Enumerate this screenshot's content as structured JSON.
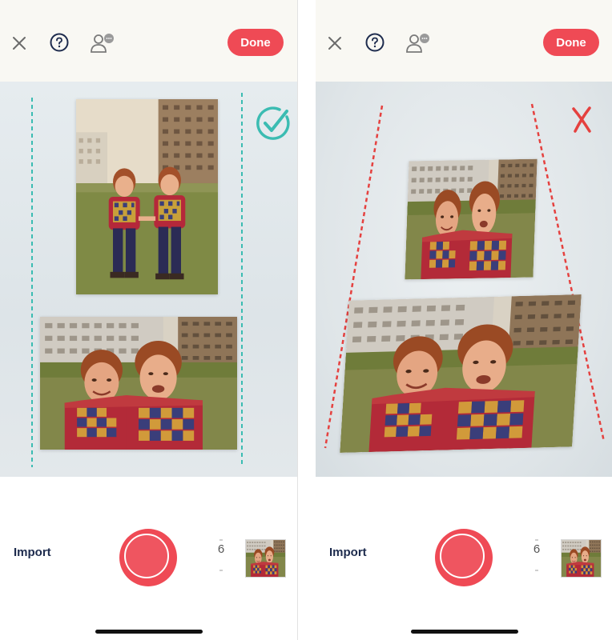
{
  "screens": [
    {
      "id": "left",
      "done_label": "Done",
      "import_label": "Import",
      "photo_count": "6",
      "status_icon": "check-circle-icon",
      "guide_color": "#3bbcb2"
    },
    {
      "id": "right",
      "done_label": "Done",
      "import_label": "Import",
      "photo_count": "6",
      "status_icon": "x-mark-icon",
      "guide_color": "#e5413f"
    }
  ],
  "colors": {
    "accent": "#ef4a55",
    "navy": "#1d2b4d",
    "topbar_bg": "#f9f8f3"
  },
  "icons": [
    "close-icon",
    "help-icon",
    "people-chat-icon",
    "shutter-icon"
  ]
}
